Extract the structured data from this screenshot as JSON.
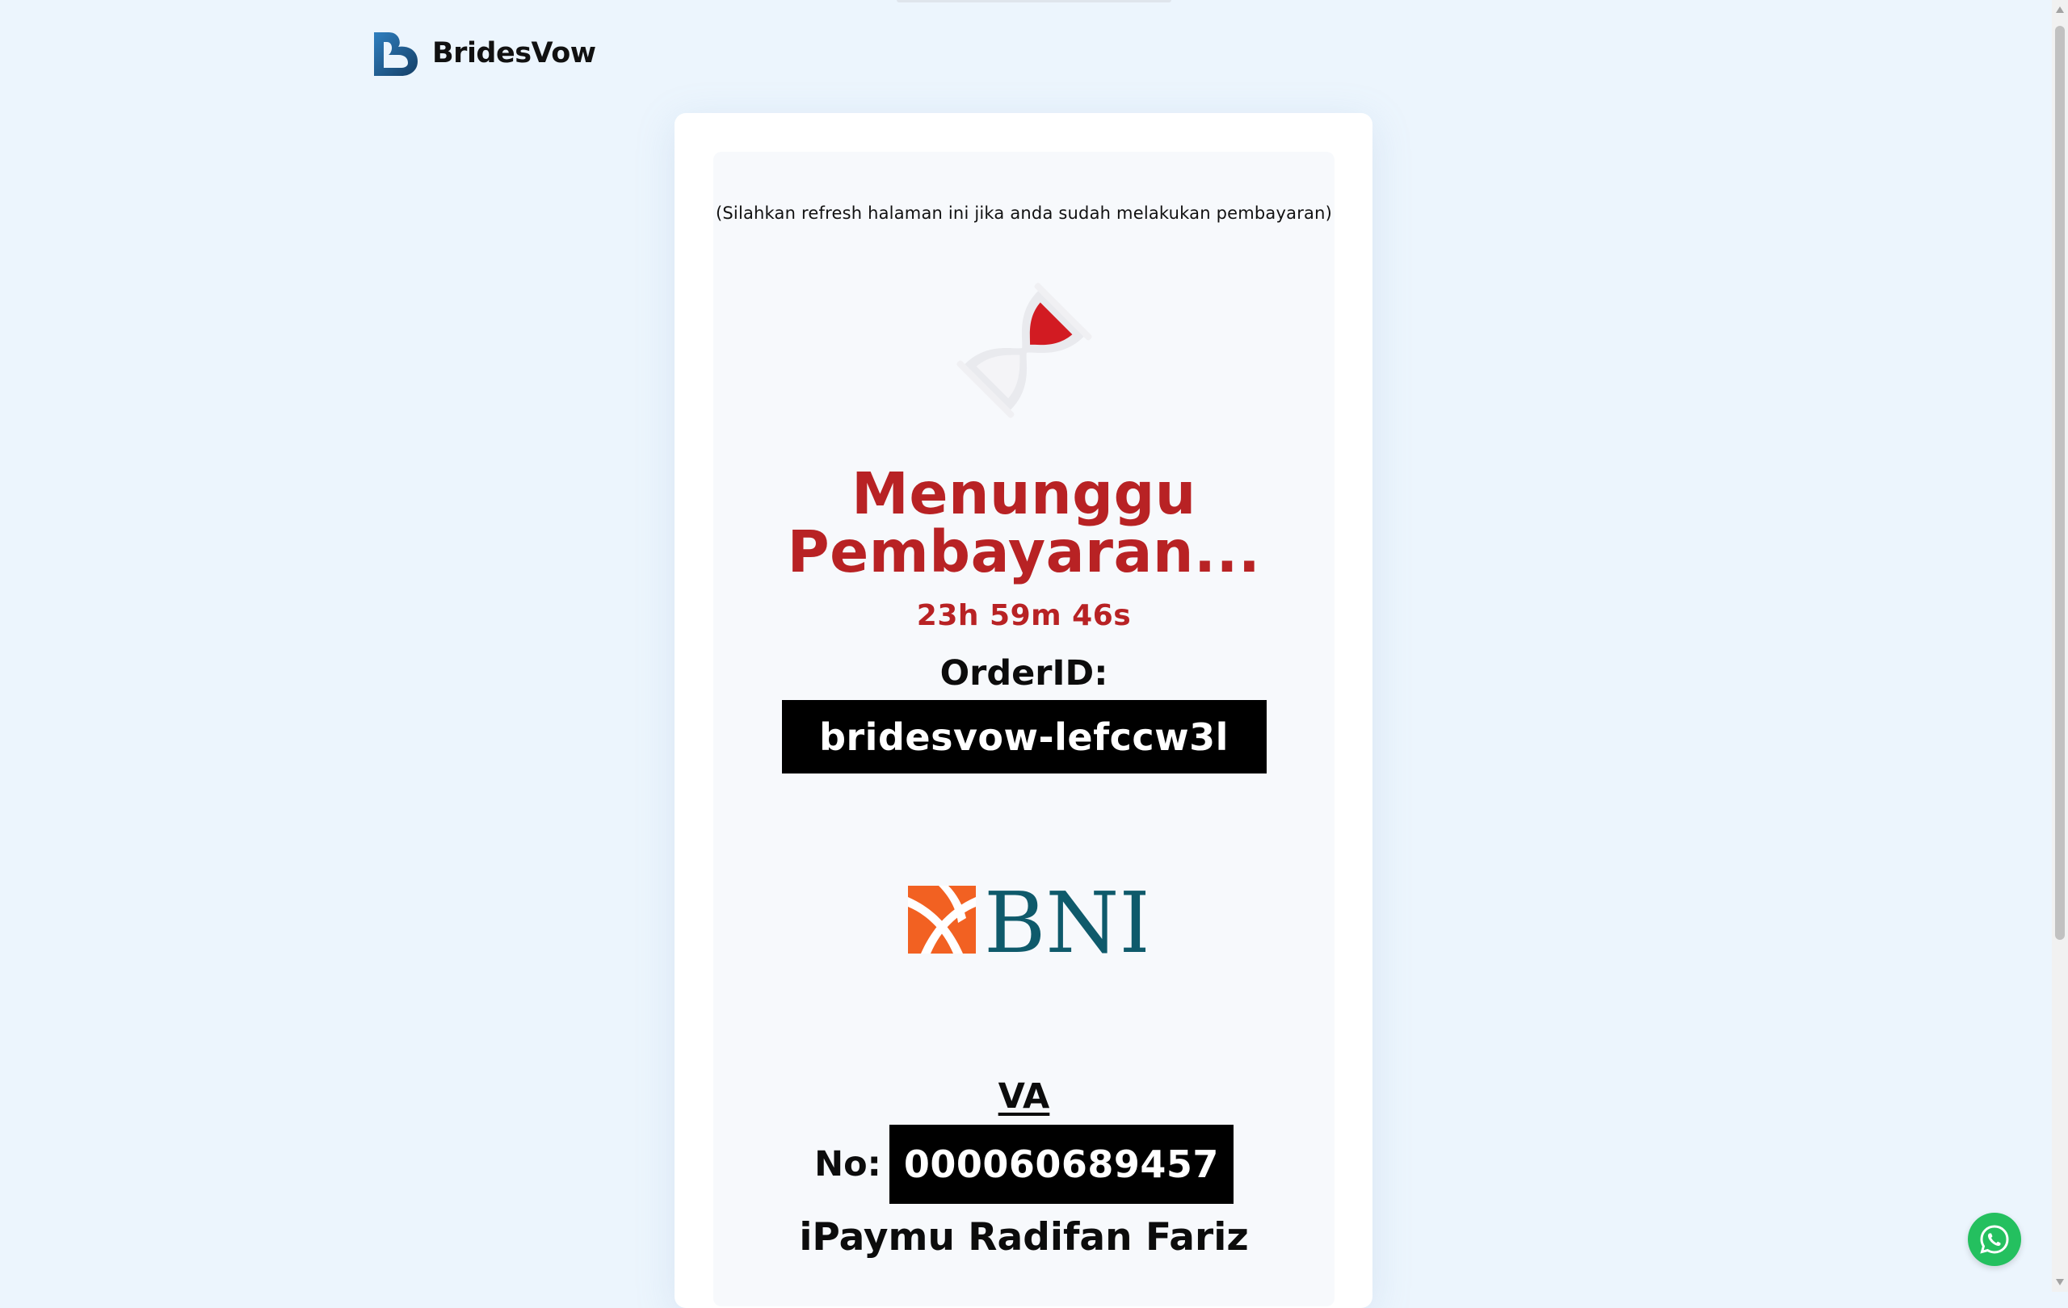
{
  "brand": {
    "name": "BridesVow",
    "logo_icon": "heart-logo-icon",
    "logo_color": "#1d5a8a"
  },
  "payment": {
    "refresh_note": "(Silahkan refresh halaman ini jika anda sudah melakukan pembayaran)",
    "status_icon": "hourglass-icon",
    "title_line1": "Menunggu",
    "title_line2": "Pembayaran...",
    "countdown": "23h 59m 46s",
    "order_id_label": "OrderID:",
    "order_id": "bridesvow-lefccw3l",
    "bank_logo_text": "BNI",
    "va_label": "VA",
    "va_no_label": "No:",
    "va_number": "000060689457",
    "account_name": "iPaymu Radifan Fariz"
  },
  "colors": {
    "page_bg": "#ecf5fd",
    "accent_red": "#b82224",
    "bni_orange": "#f26122",
    "bni_teal": "#0f5a6b",
    "whatsapp_green": "#24c05f"
  },
  "floating": {
    "whatsapp_icon": "whatsapp-icon"
  }
}
